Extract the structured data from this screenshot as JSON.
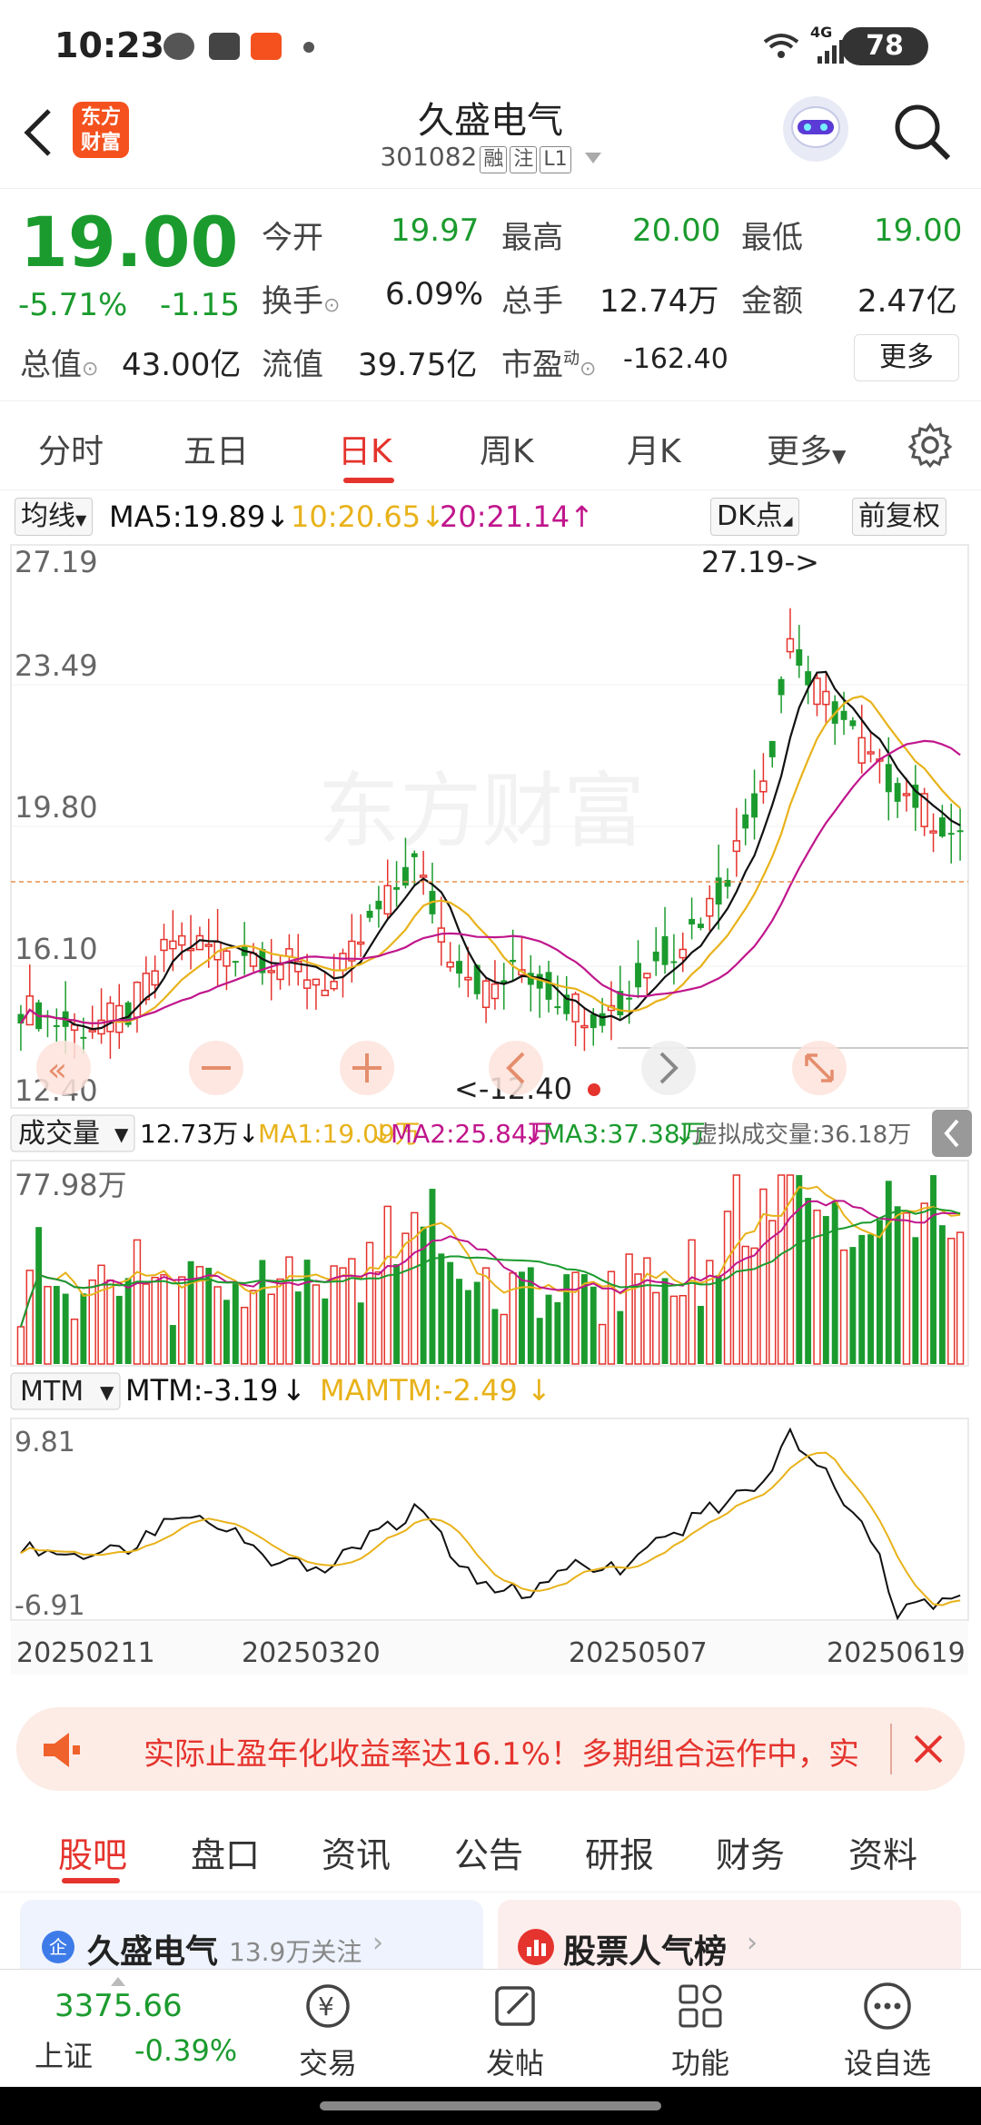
{
  "status": {
    "time": "10:23",
    "battery": "78",
    "network": "4G"
  },
  "header": {
    "logo_line1": "东方",
    "logo_line2": "财富",
    "stock_name": "久盛电气",
    "stock_code": "301082",
    "tags": [
      "融",
      "注",
      "L1"
    ]
  },
  "quote": {
    "price": "19.00",
    "change_pct": "-5.71%",
    "change_abs": "-1.15",
    "fields": [
      {
        "label": "今开",
        "value": "19.97",
        "color": "green"
      },
      {
        "label": "最高",
        "value": "20.00",
        "color": "green"
      },
      {
        "label": "最低",
        "value": "19.00",
        "color": "green"
      },
      {
        "label": "换手",
        "value": "6.09%",
        "color": "normal"
      },
      {
        "label": "总手",
        "value": "12.74万",
        "color": "normal"
      },
      {
        "label": "金额",
        "value": "2.47亿",
        "color": "normal"
      },
      {
        "label": "总值",
        "value": "43.00亿",
        "color": "normal"
      },
      {
        "label": "流值",
        "value": "39.75亿",
        "color": "normal"
      },
      {
        "label": "市盈",
        "value": "-162.40",
        "color": "normal"
      }
    ],
    "pe_superscript": "动",
    "more_label": "更多"
  },
  "ktabs": [
    "分时",
    "五日",
    "日K",
    "周K",
    "月K",
    "更多"
  ],
  "ktab_active": 2,
  "mabar": {
    "selector": "均线",
    "ma5": "MA5:19.89",
    "ma10": "10:20.65",
    "ma20": "20:21.14",
    "dk": "DK点",
    "adjust": "前复权"
  },
  "kchart": {
    "y_labels": [
      "27.19",
      "23.49",
      "19.80",
      "16.10",
      "12.40"
    ],
    "max_label": "27.19->",
    "min_label": "<-12.40",
    "watermark": "东方财富"
  },
  "volume": {
    "selector": "成交量",
    "value": "12.73万",
    "ma1": "MA1:19.09万",
    "ma2": "MA2:25.84万",
    "ma3": "MA3:37.38万",
    "virtual": "虚拟成交量:36.18万",
    "max_label": "77.98万"
  },
  "mtm": {
    "selector": "MTM",
    "mtm": "MTM:-3.19",
    "mamtm": "MAMTM:-2.49",
    "max_label": "9.81",
    "min_label": "-6.91"
  },
  "dates": [
    "20250211",
    "20250320",
    "20250507",
    "20250619"
  ],
  "banner": {
    "text": "实际止盈年化收益率达16.1%！多期组合运作中，实"
  },
  "btabs": [
    "股吧",
    "盘口",
    "资讯",
    "公告",
    "研报",
    "财务",
    "资料"
  ],
  "btab_active": 0,
  "cards": [
    {
      "title": "久盛电气",
      "sub": "13.9万关注"
    },
    {
      "title": "股票人气榜",
      "sub": ""
    }
  ],
  "bnav": {
    "index_value": "3375.66",
    "index_name": "上证",
    "index_change": "-0.39%",
    "items": [
      "交易",
      "发帖",
      "功能",
      "设自选"
    ]
  },
  "colors": {
    "up": "#e5332d",
    "down": "#1b9b2e",
    "ma5": "#111111",
    "ma10": "#e8b21a",
    "ma20": "#c0168c"
  }
}
